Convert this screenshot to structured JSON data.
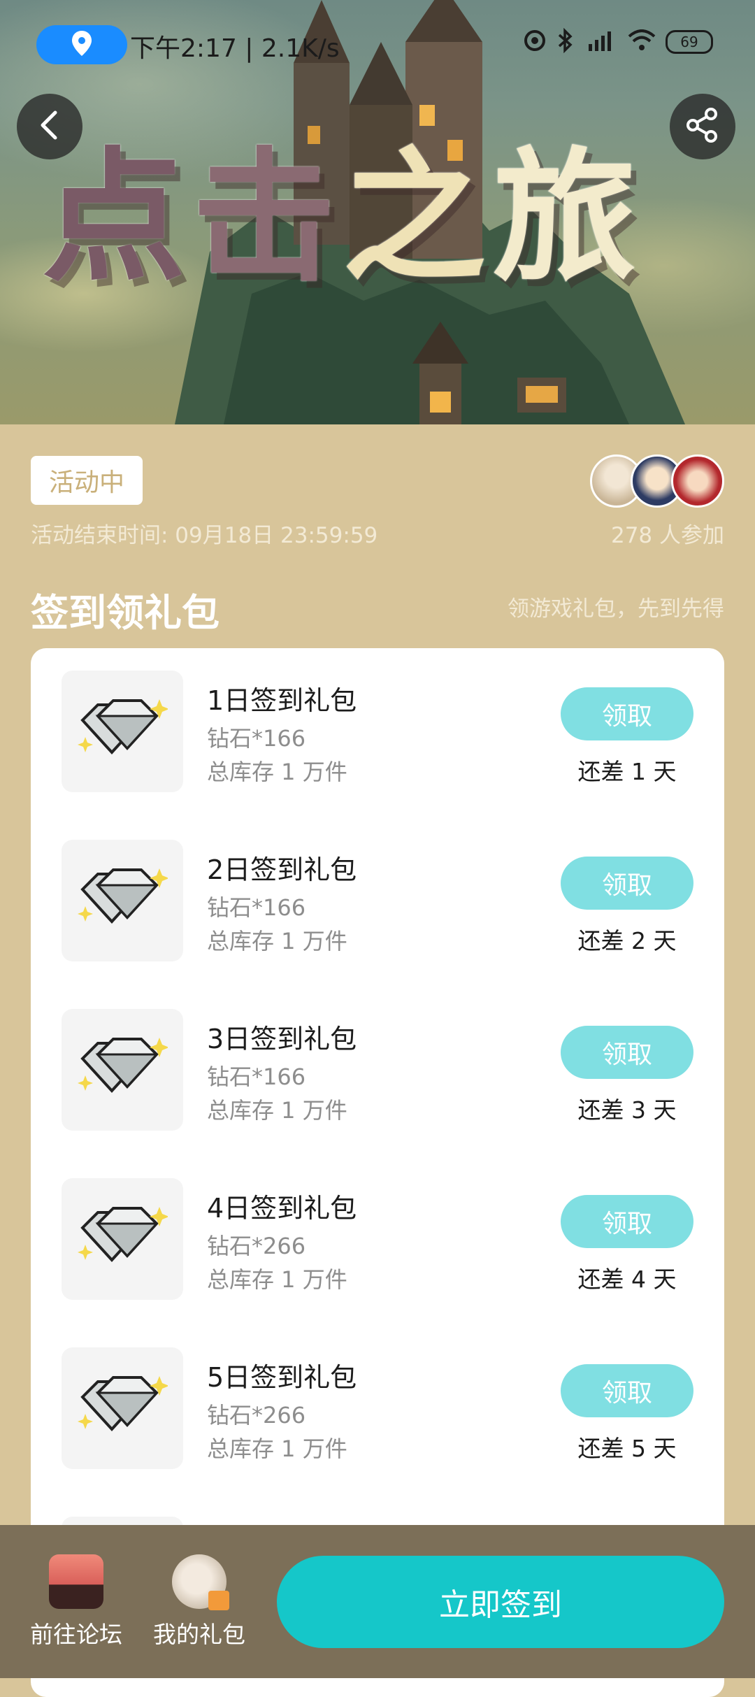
{
  "status_bar": {
    "text": "下午2:17 | 2.1K/s",
    "battery": "69",
    "icons": [
      "location-icon",
      "hotspot-icon",
      "bluetooth-icon",
      "hd-signal-icon",
      "wifi-icon",
      "battery-icon"
    ]
  },
  "header": {
    "title_chars": [
      "点",
      "击",
      "之",
      "旅"
    ],
    "back_icon": "chevron-left-icon",
    "share_icon": "share-icon"
  },
  "event": {
    "status_badge": "活动中",
    "end_time": "活动结束时间: 09月18日 23:59:59",
    "participants": "278 人参加"
  },
  "section": {
    "title": "签到领礼包",
    "subtitle": "领游戏礼包，先到先得"
  },
  "gifts": [
    {
      "title": "1日签到礼包",
      "diamond": "钻石*166",
      "stock": "总库存 1 万件",
      "button": "领取",
      "days_left": "还差 1 天"
    },
    {
      "title": "2日签到礼包",
      "diamond": "钻石*166",
      "stock": "总库存 1 万件",
      "button": "领取",
      "days_left": "还差 2 天"
    },
    {
      "title": "3日签到礼包",
      "diamond": "钻石*166",
      "stock": "总库存 1 万件",
      "button": "领取",
      "days_left": "还差 3 天"
    },
    {
      "title": "4日签到礼包",
      "diamond": "钻石*266",
      "stock": "总库存 1 万件",
      "button": "领取",
      "days_left": "还差 4 天"
    },
    {
      "title": "5日签到礼包",
      "diamond": "钻石*266",
      "stock": "总库存 1 万件",
      "button": "领取",
      "days_left": "还差 5 天"
    }
  ],
  "bottom_bar": {
    "forum_label": "前往论坛",
    "gifts_label": "我的礼包",
    "sign_label": "立即签到"
  },
  "colors": {
    "page_bg": "#d8c59a",
    "claim_button": "#80dfe2",
    "sign_button": "#15c7c9",
    "bottom_bar": "#7c6f58"
  }
}
